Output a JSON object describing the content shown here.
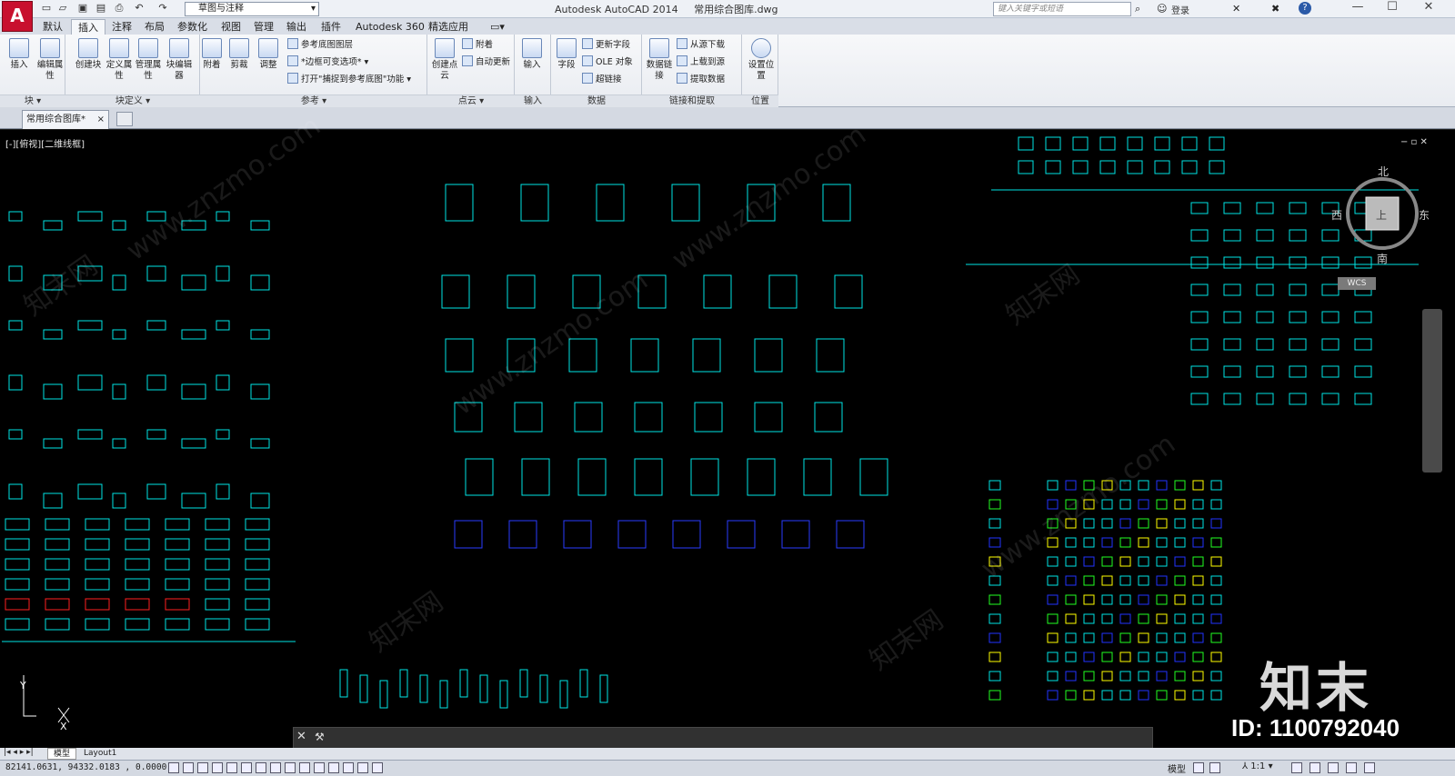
{
  "quick_access": {
    "workspace": "草图与注释"
  },
  "title": {
    "app": "Autodesk AutoCAD 2014",
    "file": "常用综合图库.dwg"
  },
  "search": {
    "placeholder": "键入关键字或短语"
  },
  "account": {
    "login": "登录"
  },
  "menu_tabs": [
    "默认",
    "插入",
    "注释",
    "布局",
    "参数化",
    "视图",
    "管理",
    "输出",
    "插件",
    "Autodesk 360",
    "精选应用"
  ],
  "active_tab": "插入",
  "ribbon": {
    "block": {
      "label": "块",
      "insert": "插入",
      "edit_attr": "编辑属性"
    },
    "block_def": {
      "label": "块定义",
      "create": "创建块",
      "define_attr": "定义属性",
      "manage_attr": "管理属性",
      "block_editor": "块编辑器"
    },
    "reference": {
      "label": "参考",
      "attach": "附着",
      "clip": "剪裁",
      "adjust": "调整",
      "underlay_layers": "参考底图图层",
      "frames": "*边框可变选项*",
      "snap": "打开\"捕捉到参考底图\"功能"
    },
    "pointcloud": {
      "label": "点云",
      "create": "创建点云",
      "attach": "附着",
      "auto_update": "自动更新"
    },
    "import": {
      "label": "输入",
      "import": "输入"
    },
    "data": {
      "label": "数据",
      "field": "字段",
      "update_fields": "更新字段",
      "ole": "OLE 对象",
      "hyperlink": "超链接"
    },
    "link": {
      "label": "链接和提取",
      "data_link": "数据链接",
      "download": "从源下载",
      "upload": "上载到源",
      "extract": "提取数据"
    },
    "location": {
      "label": "位置",
      "set_location": "设置位置"
    }
  },
  "doc_tab": "常用综合图库*",
  "viewport": {
    "label": "[-][俯视][二维线框]"
  },
  "compass": {
    "north": "北",
    "south": "南",
    "east": "东",
    "west": "西",
    "top": "上",
    "wcs": "WCS"
  },
  "axis": {
    "y": "Y",
    "x": "X"
  },
  "layouts": [
    "模型",
    "Layout1"
  ],
  "status": {
    "coords": "82141.0631, 94332.0183 , 0.0000",
    "model": "模型",
    "scale": "1:1"
  },
  "watermark": {
    "site": "www.znzmo.com",
    "brand": "知末网",
    "logo": "知末",
    "id": "ID: 1100792040"
  },
  "colors": {
    "accent": "#c8102e",
    "cyan": "#00e5e5",
    "blue": "#2233ff",
    "yellow": "#ffff00",
    "red": "#ff2020",
    "green": "#22ff22"
  }
}
